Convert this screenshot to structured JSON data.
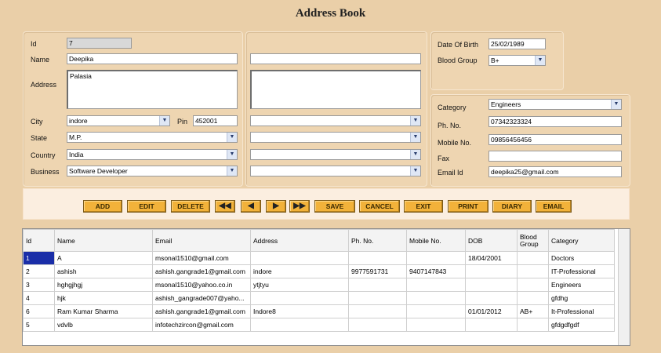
{
  "title": "Address Book",
  "form": {
    "id_label": "Id",
    "id_value": "7",
    "name_label": "Name",
    "name_value": "Deepika",
    "name2_value": "",
    "address_label": "Address",
    "address_value": "Palasia",
    "address2_value": "",
    "city_label": "City",
    "city_value": "indore",
    "pin_label": "Pin",
    "pin_value": "452001",
    "state_label": "State",
    "state_value": "M.P.",
    "country_label": "Country",
    "country_value": "India",
    "business_label": "Business",
    "business_value": "Software Developer",
    "dob_label": "Date Of Birth",
    "dob_value": "25/02/1989",
    "blood_label": "Blood Group",
    "blood_value": "B+",
    "category_label": "Category",
    "category_value": "Engineers",
    "phone_label": "Ph. No.",
    "phone_value": "07342323324",
    "mobile_label": "Mobile No.",
    "mobile_value": "09856456456",
    "fax_label": "Fax",
    "fax_value": "",
    "email_label": "Email Id",
    "email_value": "deepika25@gmail.com"
  },
  "toolbar": {
    "add": "ADD",
    "edit": "EDIT",
    "delete": "DELETE",
    "first": "◀◀",
    "prev": "◀",
    "next": "▶",
    "last": "▶▶",
    "save": "SAVE",
    "cancel": "CANCEL",
    "exit": "EXIT",
    "print": "PRINT",
    "diary": "DIARY",
    "email": "EMAIL"
  },
  "grid": {
    "headers": [
      "Id",
      "Name",
      "Email",
      "Address",
      "Ph. No.",
      "Mobile No.",
      "DOB",
      "Blood Group",
      "Category"
    ],
    "rows": [
      [
        "1",
        "A",
        "msonal1510@gmail.com",
        "",
        "",
        "",
        "18/04/2001",
        "",
        "Doctors"
      ],
      [
        "2",
        "ashish",
        "ashish.gangrade1@gmail.com",
        "indore",
        "9977591731",
        "9407147843",
        "",
        "",
        "IT-Professional"
      ],
      [
        "3",
        "hghgjhgj",
        "msonal1510@yahoo.co.in",
        "ytjtyu",
        "",
        "",
        "",
        "",
        "Engineers"
      ],
      [
        "4",
        "hjk",
        "ashish_gangrade007@yaho...",
        "",
        "",
        "",
        "",
        "",
        "gfdhg"
      ],
      [
        "6",
        "Ram Kumar Sharma",
        "ashish.gangrade1@gmail.com",
        "Indore8",
        "",
        "",
        "01/01/2012",
        "AB+",
        "It-Professional"
      ],
      [
        "5",
        "vdvlb",
        "infotechzircon@gmail.com",
        "",
        "",
        "",
        "",
        "",
        "gfdgdfgdf"
      ]
    ]
  }
}
